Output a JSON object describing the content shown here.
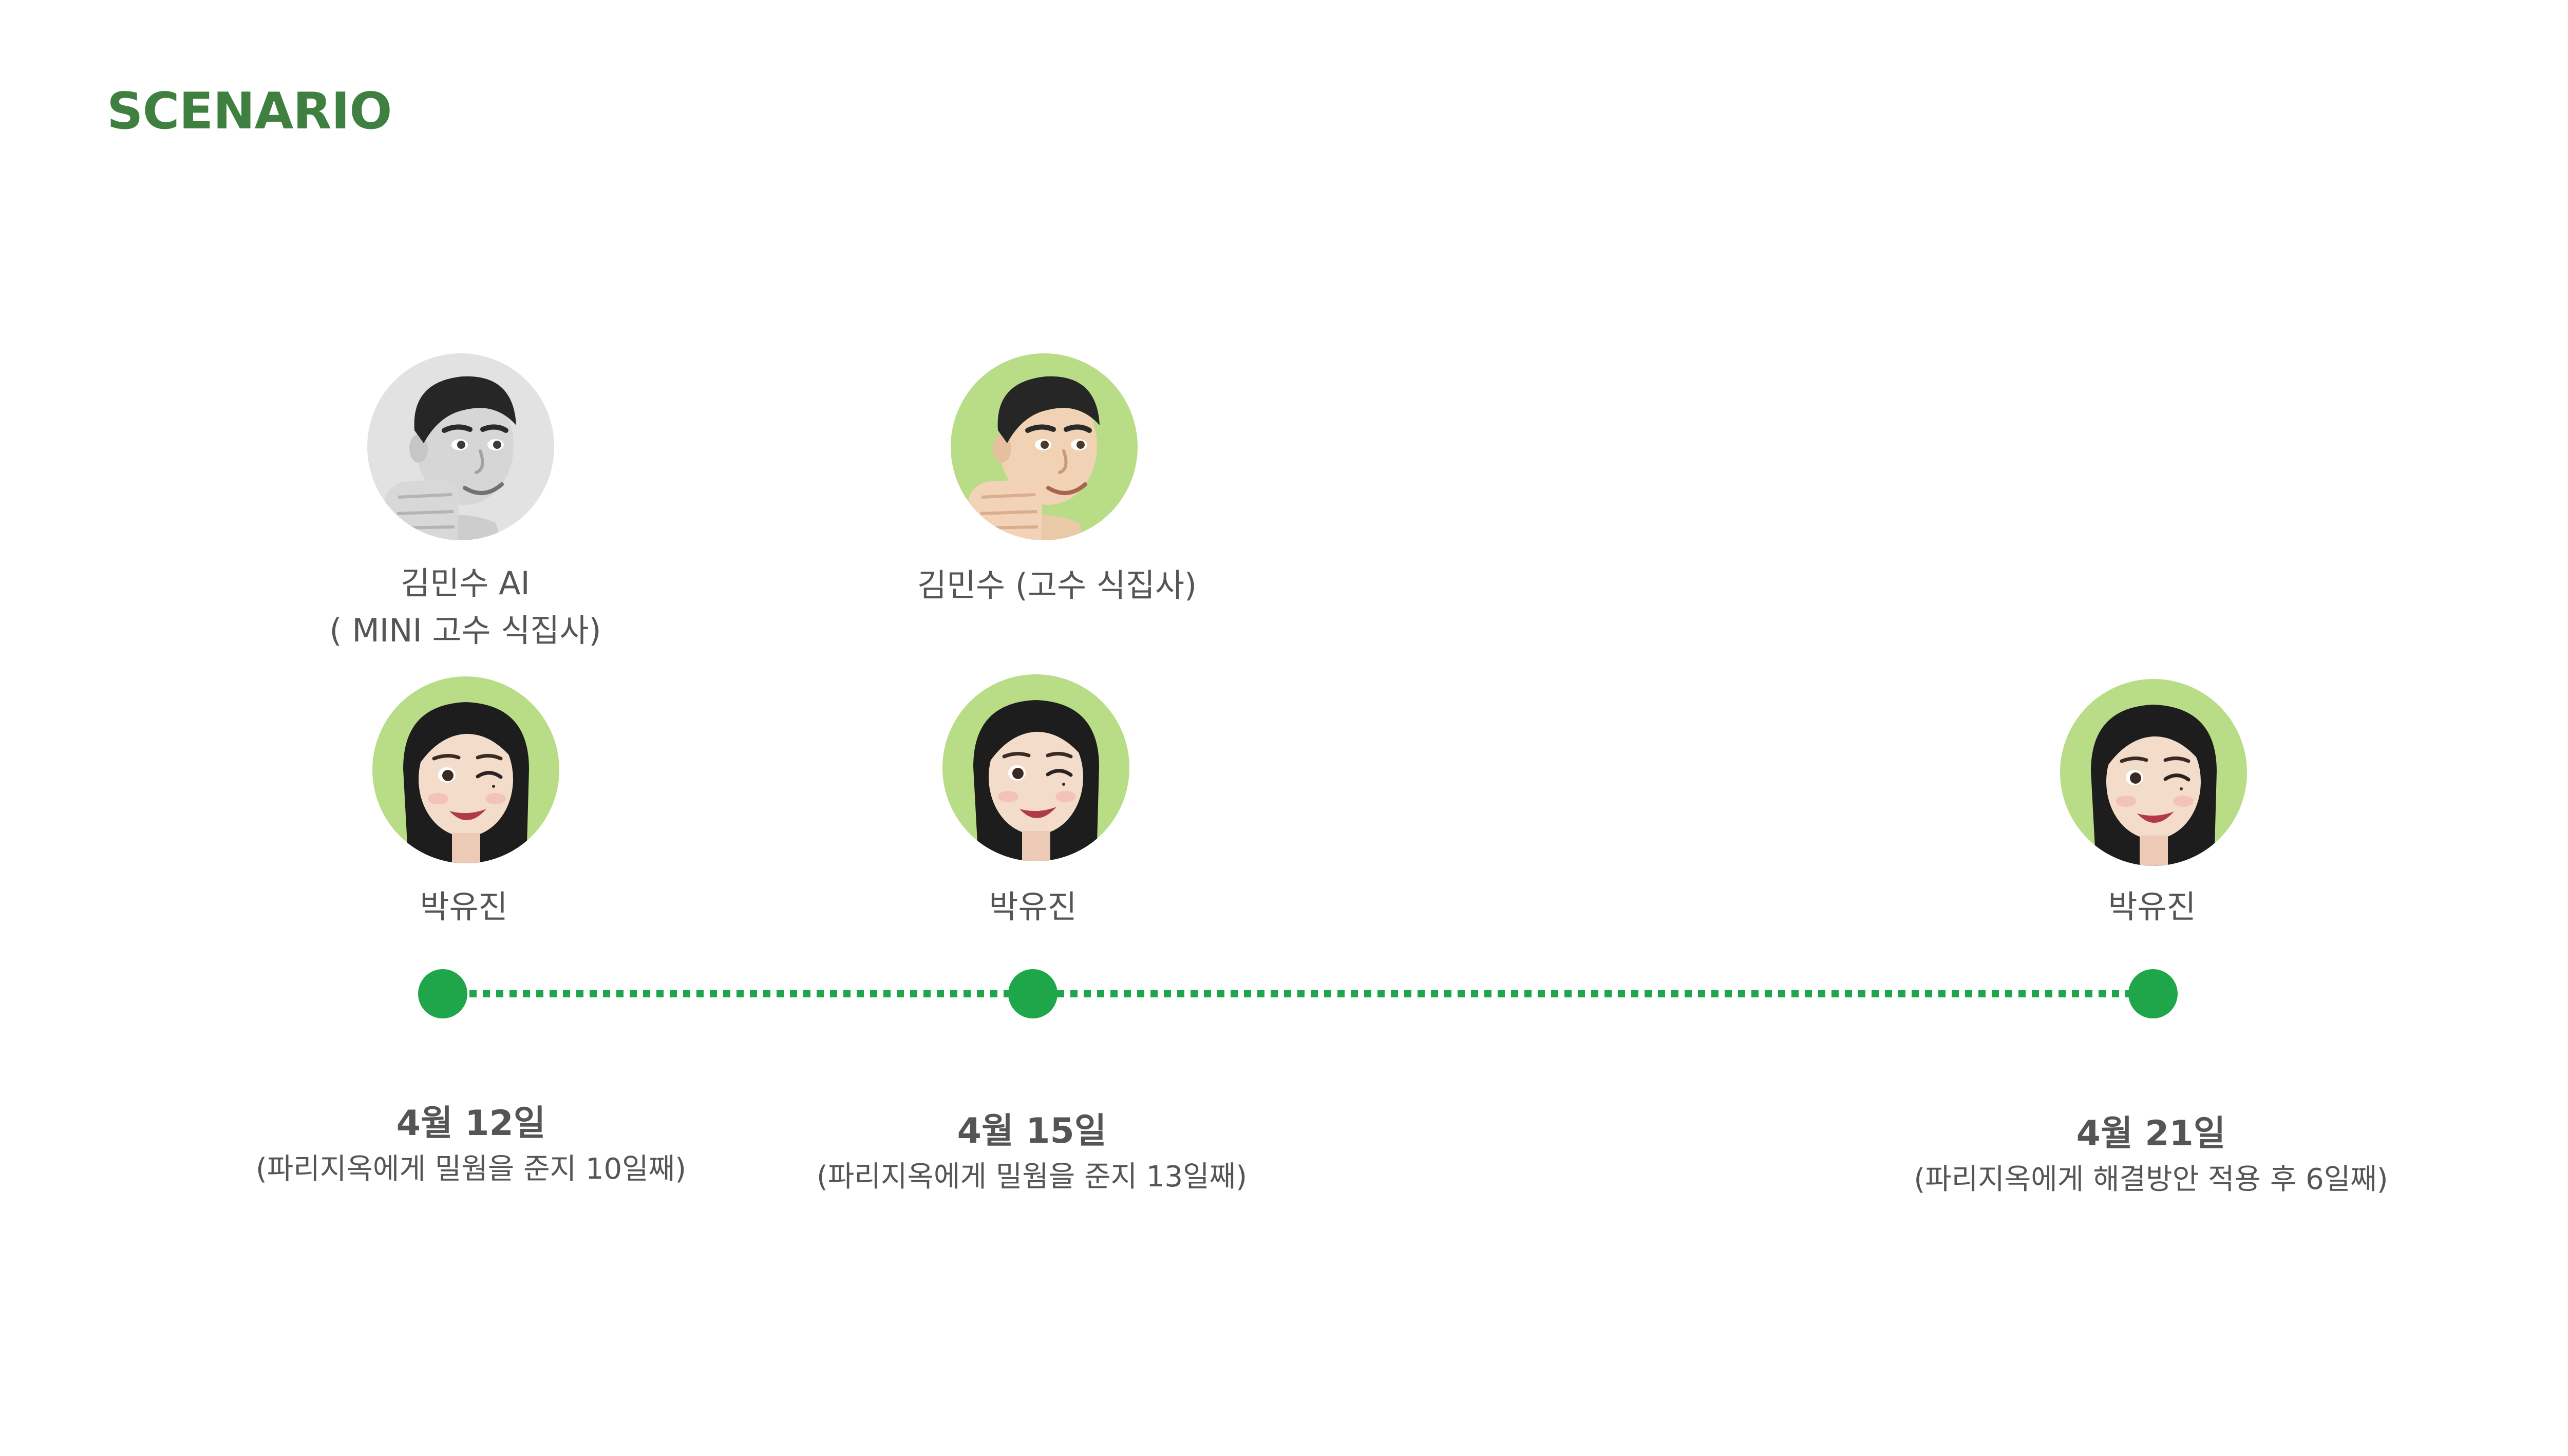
{
  "title": "SCENARIO",
  "colors": {
    "title": "#3f8040",
    "timeline": "#1fa64a",
    "avatar_bg_green": "#b8dd86",
    "avatar_bg_gray": "#e2e2e2",
    "text": "#555555"
  },
  "mentors": [
    {
      "name": "김민수 AI",
      "role": "( MINI 고수 식집사)",
      "icon": "man-fist-memoji-grayscale"
    },
    {
      "name": "김민수 (고수 식집사)",
      "icon": "man-fist-memoji"
    }
  ],
  "users": [
    {
      "name": "박유진",
      "icon": "woman-wink-memoji"
    },
    {
      "name": "박유진",
      "icon": "woman-wink-memoji"
    },
    {
      "name": "박유진",
      "icon": "woman-wink-memoji"
    }
  ],
  "milestones": [
    {
      "date": "4월 12일",
      "note": "(파리지옥에게 밀웜을 준지 10일째)"
    },
    {
      "date": "4월 15일",
      "note": "(파리지옥에게 밀웜을 준지 13일째)"
    },
    {
      "date": "4월 21일",
      "note": "(파리지옥에게 해결방안 적용 후 6일째)"
    }
  ]
}
